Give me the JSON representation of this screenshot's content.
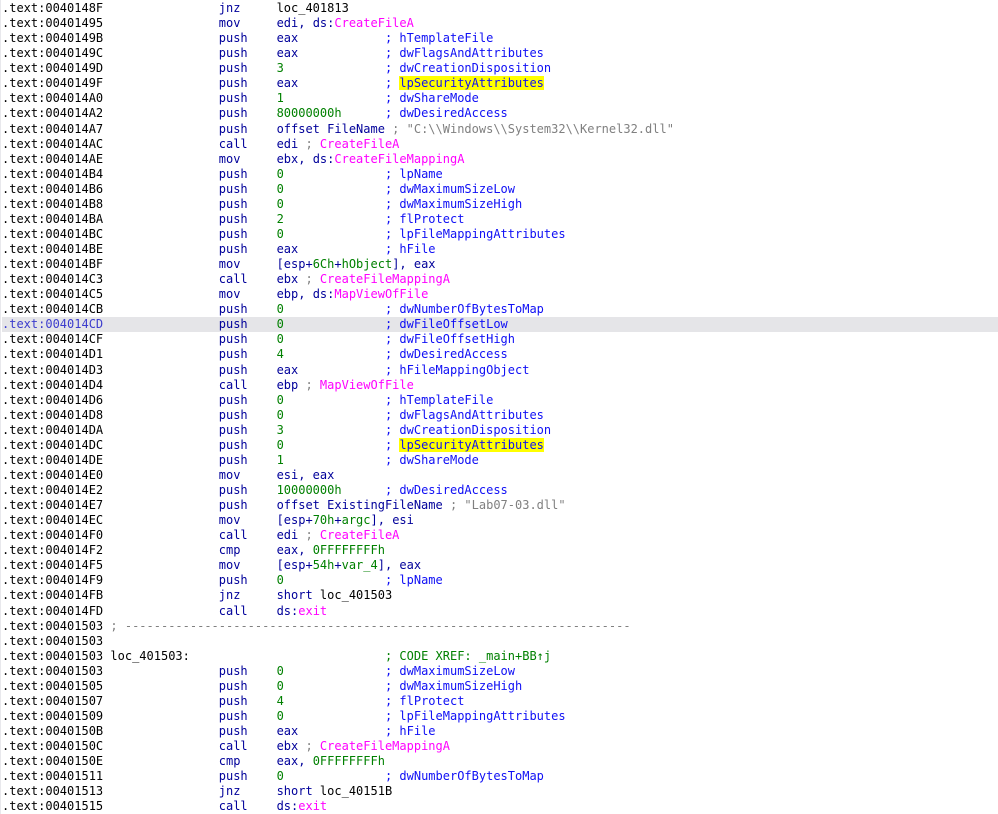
{
  "colors": {
    "bg": "#ffffff",
    "sel-bg": "#e5e5e8",
    "addr": "#000000",
    "addr-sel": "#3c3ccd",
    "kw": "#00009a",
    "num": "#008000",
    "cmt": "#0f0ff5",
    "imp": "#ff00ff",
    "str": "#808080",
    "gry": "#808080",
    "xref": "#008000",
    "loc": "#000000",
    "hl-bg": "#ffff00"
  },
  "listing": {
    "lines": [
      {
        "addr": ".text:0040148F",
        "mn": "jnz",
        "ops": [
          [
            "loc_401813",
            "loc"
          ]
        ]
      },
      {
        "addr": ".text:00401495",
        "mn": "mov",
        "ops": [
          [
            "edi, ",
            "kw"
          ],
          [
            "ds:",
            "kw"
          ],
          [
            "CreateFileA",
            "imp"
          ]
        ]
      },
      {
        "addr": ".text:0040149B",
        "mn": "push",
        "ops": [
          [
            "eax",
            "kw"
          ]
        ],
        "cmt": [
          [
            "; hTemplateFile",
            "cmt"
          ]
        ]
      },
      {
        "addr": ".text:0040149C",
        "mn": "push",
        "ops": [
          [
            "eax",
            "kw"
          ]
        ],
        "cmt": [
          [
            "; dwFlagsAndAttributes",
            "cmt"
          ]
        ]
      },
      {
        "addr": ".text:0040149D",
        "mn": "push",
        "ops": [
          [
            "3",
            "num"
          ]
        ],
        "cmt": [
          [
            "; dwCreationDisposition",
            "cmt"
          ]
        ]
      },
      {
        "addr": ".text:0040149F",
        "mn": "push",
        "ops": [
          [
            "eax",
            "kw"
          ]
        ],
        "cmt": [
          [
            "; ",
            "cmt"
          ],
          [
            "lpSecurityAttributes",
            "cmt hl"
          ]
        ]
      },
      {
        "addr": ".text:004014A0",
        "mn": "push",
        "ops": [
          [
            "1",
            "num"
          ]
        ],
        "cmt": [
          [
            "; dwShareMode",
            "cmt"
          ]
        ]
      },
      {
        "addr": ".text:004014A2",
        "mn": "push",
        "ops": [
          [
            "80000000h",
            "num"
          ]
        ],
        "cmt": [
          [
            "; dwDesiredAccess",
            "cmt"
          ]
        ]
      },
      {
        "addr": ".text:004014A7",
        "mn": "push",
        "ops": [
          [
            "offset ",
            "kw"
          ],
          [
            "FileName",
            "kw"
          ]
        ],
        "cmt": [
          [
            "; \"C:\\\\Windows\\\\System32\\\\Kernel32.dll\"",
            "str"
          ]
        ]
      },
      {
        "addr": ".text:004014AC",
        "mn": "call",
        "ops": [
          [
            "edi ",
            "kw"
          ],
          [
            "; ",
            "gry"
          ],
          [
            "CreateFileA",
            "imp"
          ]
        ]
      },
      {
        "addr": ".text:004014AE",
        "mn": "mov",
        "ops": [
          [
            "ebx, ",
            "kw"
          ],
          [
            "ds:",
            "kw"
          ],
          [
            "CreateFileMappingA",
            "imp"
          ]
        ]
      },
      {
        "addr": ".text:004014B4",
        "mn": "push",
        "ops": [
          [
            "0",
            "num"
          ]
        ],
        "cmt": [
          [
            "; lpName",
            "cmt"
          ]
        ]
      },
      {
        "addr": ".text:004014B6",
        "mn": "push",
        "ops": [
          [
            "0",
            "num"
          ]
        ],
        "cmt": [
          [
            "; dwMaximumSizeLow",
            "cmt"
          ]
        ]
      },
      {
        "addr": ".text:004014B8",
        "mn": "push",
        "ops": [
          [
            "0",
            "num"
          ]
        ],
        "cmt": [
          [
            "; dwMaximumSizeHigh",
            "cmt"
          ]
        ]
      },
      {
        "addr": ".text:004014BA",
        "mn": "push",
        "ops": [
          [
            "2",
            "num"
          ]
        ],
        "cmt": [
          [
            "; flProtect",
            "cmt"
          ]
        ]
      },
      {
        "addr": ".text:004014BC",
        "mn": "push",
        "ops": [
          [
            "0",
            "num"
          ]
        ],
        "cmt": [
          [
            "; lpFileMappingAttributes",
            "cmt"
          ]
        ]
      },
      {
        "addr": ".text:004014BE",
        "mn": "push",
        "ops": [
          [
            "eax",
            "kw"
          ]
        ],
        "cmt": [
          [
            "; hFile",
            "cmt"
          ]
        ]
      },
      {
        "addr": ".text:004014BF",
        "mn": "mov",
        "ops": [
          [
            "[esp+",
            "kw"
          ],
          [
            "6Ch",
            "num"
          ],
          [
            "+",
            "kw"
          ],
          [
            "hObject",
            "num"
          ],
          [
            "], eax",
            "kw"
          ]
        ]
      },
      {
        "addr": ".text:004014C3",
        "mn": "call",
        "ops": [
          [
            "ebx ",
            "kw"
          ],
          [
            "; ",
            "gry"
          ],
          [
            "CreateFileMappingA",
            "imp"
          ]
        ]
      },
      {
        "addr": ".text:004014C5",
        "mn": "mov",
        "ops": [
          [
            "ebp, ",
            "kw"
          ],
          [
            "ds:",
            "kw"
          ],
          [
            "MapViewOfFile",
            "imp"
          ]
        ]
      },
      {
        "addr": ".text:004014CB",
        "mn": "push",
        "ops": [
          [
            "0",
            "num"
          ]
        ],
        "cmt": [
          [
            "; dwNumberOfBytesToMap",
            "cmt"
          ]
        ]
      },
      {
        "addr": ".text:004014CD",
        "sel": true,
        "mn": "push",
        "ops": [
          [
            "0",
            "num"
          ]
        ],
        "cmt": [
          [
            "; dwFileOffsetLow",
            "cmt"
          ]
        ]
      },
      {
        "addr": ".text:004014CF",
        "mn": "push",
        "ops": [
          [
            "0",
            "num"
          ]
        ],
        "cmt": [
          [
            "; dwFileOffsetHigh",
            "cmt"
          ]
        ]
      },
      {
        "addr": ".text:004014D1",
        "mn": "push",
        "ops": [
          [
            "4",
            "num"
          ]
        ],
        "cmt": [
          [
            "; dwDesiredAccess",
            "cmt"
          ]
        ]
      },
      {
        "addr": ".text:004014D3",
        "mn": "push",
        "ops": [
          [
            "eax",
            "kw"
          ]
        ],
        "cmt": [
          [
            "; hFileMappingObject",
            "cmt"
          ]
        ]
      },
      {
        "addr": ".text:004014D4",
        "mn": "call",
        "ops": [
          [
            "ebp ",
            "kw"
          ],
          [
            "; ",
            "gry"
          ],
          [
            "MapViewOfFile",
            "imp"
          ]
        ]
      },
      {
        "addr": ".text:004014D6",
        "mn": "push",
        "ops": [
          [
            "0",
            "num"
          ]
        ],
        "cmt": [
          [
            "; hTemplateFile",
            "cmt"
          ]
        ]
      },
      {
        "addr": ".text:004014D8",
        "mn": "push",
        "ops": [
          [
            "0",
            "num"
          ]
        ],
        "cmt": [
          [
            "; dwFlagsAndAttributes",
            "cmt"
          ]
        ]
      },
      {
        "addr": ".text:004014DA",
        "mn": "push",
        "ops": [
          [
            "3",
            "num"
          ]
        ],
        "cmt": [
          [
            "; dwCreationDisposition",
            "cmt"
          ]
        ]
      },
      {
        "addr": ".text:004014DC",
        "mn": "push",
        "ops": [
          [
            "0",
            "num"
          ]
        ],
        "cmt": [
          [
            "; ",
            "cmt"
          ],
          [
            "lpSecurityAttributes",
            "cmt hl"
          ]
        ]
      },
      {
        "addr": ".text:004014DE",
        "mn": "push",
        "ops": [
          [
            "1",
            "num"
          ]
        ],
        "cmt": [
          [
            "; dwShareMode",
            "cmt"
          ]
        ]
      },
      {
        "addr": ".text:004014E0",
        "mn": "mov",
        "ops": [
          [
            "esi, eax",
            "kw"
          ]
        ]
      },
      {
        "addr": ".text:004014E2",
        "mn": "push",
        "ops": [
          [
            "10000000h",
            "num"
          ]
        ],
        "cmt": [
          [
            "; dwDesiredAccess",
            "cmt"
          ]
        ]
      },
      {
        "addr": ".text:004014E7",
        "mn": "push",
        "ops": [
          [
            "offset ",
            "kw"
          ],
          [
            "ExistingFileName",
            "kw"
          ]
        ],
        "cmt": [
          [
            "; \"Lab07-03.dll\"",
            "str"
          ]
        ]
      },
      {
        "addr": ".text:004014EC",
        "mn": "mov",
        "ops": [
          [
            "[esp+",
            "kw"
          ],
          [
            "70h",
            "num"
          ],
          [
            "+",
            "kw"
          ],
          [
            "argc",
            "num"
          ],
          [
            "], esi",
            "kw"
          ]
        ]
      },
      {
        "addr": ".text:004014F0",
        "mn": "call",
        "ops": [
          [
            "edi ",
            "kw"
          ],
          [
            "; ",
            "gry"
          ],
          [
            "CreateFileA",
            "imp"
          ]
        ]
      },
      {
        "addr": ".text:004014F2",
        "mn": "cmp",
        "ops": [
          [
            "eax, ",
            "kw"
          ],
          [
            "0FFFFFFFFh",
            "num"
          ]
        ]
      },
      {
        "addr": ".text:004014F5",
        "mn": "mov",
        "ops": [
          [
            "[esp+",
            "kw"
          ],
          [
            "54h",
            "num"
          ],
          [
            "+",
            "kw"
          ],
          [
            "var_4",
            "num"
          ],
          [
            "], eax",
            "kw"
          ]
        ]
      },
      {
        "addr": ".text:004014F9",
        "mn": "push",
        "ops": [
          [
            "0",
            "num"
          ]
        ],
        "cmt": [
          [
            "; lpName",
            "cmt"
          ]
        ]
      },
      {
        "addr": ".text:004014FB",
        "mn": "jnz",
        "ops": [
          [
            "short ",
            "kw"
          ],
          [
            "loc_401503",
            "loc"
          ]
        ]
      },
      {
        "addr": ".text:004014FD",
        "mn": "call",
        "ops": [
          [
            "ds:",
            "kw"
          ],
          [
            "exit",
            "imp"
          ]
        ]
      },
      {
        "addr": ".text:00401503",
        "label": [
          [
            "; ",
            "gry"
          ],
          [
            "----------------------------------------------------------------------",
            "gry"
          ]
        ]
      },
      {
        "addr": ".text:00401503"
      },
      {
        "addr": ".text:00401503",
        "label": [
          [
            "loc_401503:",
            "loc"
          ]
        ],
        "cmt": [
          [
            "; CODE XREF: _main+BB↑j",
            "xref"
          ]
        ]
      },
      {
        "addr": ".text:00401503",
        "mn": "push",
        "ops": [
          [
            "0",
            "num"
          ]
        ],
        "cmt": [
          [
            "; dwMaximumSizeLow",
            "cmt"
          ]
        ]
      },
      {
        "addr": ".text:00401505",
        "mn": "push",
        "ops": [
          [
            "0",
            "num"
          ]
        ],
        "cmt": [
          [
            "; dwMaximumSizeHigh",
            "cmt"
          ]
        ]
      },
      {
        "addr": ".text:00401507",
        "mn": "push",
        "ops": [
          [
            "4",
            "num"
          ]
        ],
        "cmt": [
          [
            "; flProtect",
            "cmt"
          ]
        ]
      },
      {
        "addr": ".text:00401509",
        "mn": "push",
        "ops": [
          [
            "0",
            "num"
          ]
        ],
        "cmt": [
          [
            "; lpFileMappingAttributes",
            "cmt"
          ]
        ]
      },
      {
        "addr": ".text:0040150B",
        "mn": "push",
        "ops": [
          [
            "eax",
            "kw"
          ]
        ],
        "cmt": [
          [
            "; hFile",
            "cmt"
          ]
        ]
      },
      {
        "addr": ".text:0040150C",
        "mn": "call",
        "ops": [
          [
            "ebx ",
            "kw"
          ],
          [
            "; ",
            "gry"
          ],
          [
            "CreateFileMappingA",
            "imp"
          ]
        ]
      },
      {
        "addr": ".text:0040150E",
        "mn": "cmp",
        "ops": [
          [
            "eax, ",
            "kw"
          ],
          [
            "0FFFFFFFFh",
            "num"
          ]
        ]
      },
      {
        "addr": ".text:00401511",
        "mn": "push",
        "ops": [
          [
            "0",
            "num"
          ]
        ],
        "cmt": [
          [
            "; dwNumberOfBytesToMap",
            "cmt"
          ]
        ]
      },
      {
        "addr": ".text:00401513",
        "mn": "jnz",
        "ops": [
          [
            "short ",
            "kw"
          ],
          [
            "loc_40151B",
            "loc"
          ]
        ]
      },
      {
        "addr": ".text:00401515",
        "mn": "call",
        "ops": [
          [
            "ds:",
            "kw"
          ],
          [
            "exit",
            "imp"
          ]
        ]
      }
    ]
  }
}
